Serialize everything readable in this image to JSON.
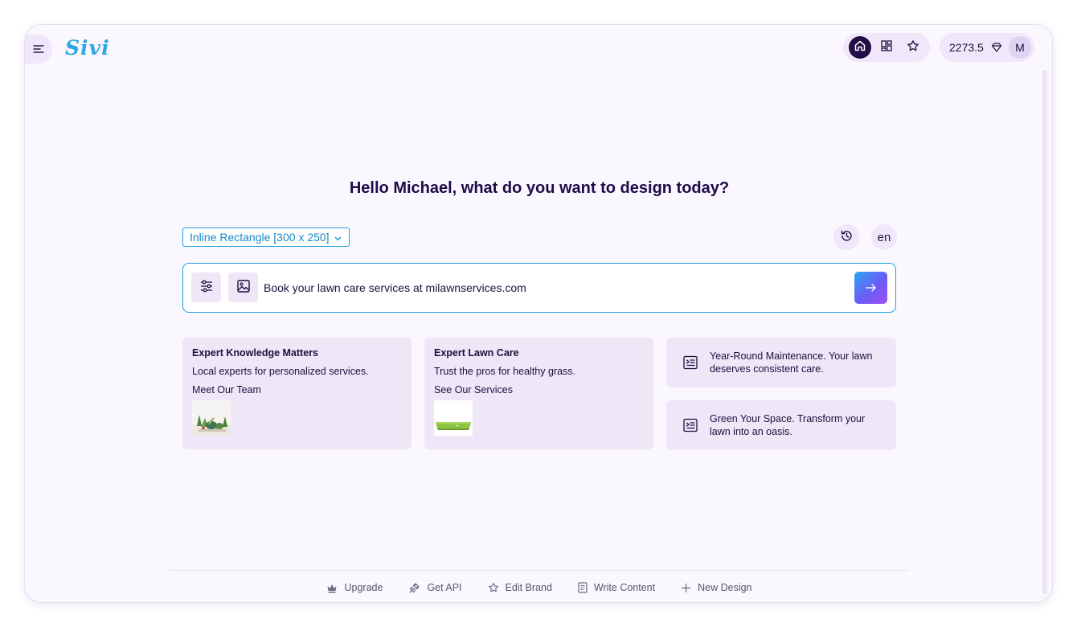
{
  "app": {
    "logo": "Sivi"
  },
  "topbar": {
    "nav": [
      {
        "name": "home",
        "icon": "home-icon",
        "active": true
      },
      {
        "name": "templates",
        "icon": "grid-icon",
        "active": false
      },
      {
        "name": "favorites",
        "icon": "star-icon",
        "active": false
      }
    ],
    "credits": "2273.5",
    "credits_icon": "diamond-icon",
    "avatar_initial": "M"
  },
  "main": {
    "headline": "Hello Michael, what do you want to design today?",
    "size_select": {
      "value": "Inline Rectangle [300 x 250]",
      "icon": "chevron-down-icon"
    },
    "language": "en",
    "prompt": {
      "value": "Book your lawn care services at milawnservices.com",
      "placeholder": ""
    }
  },
  "suggestions": {
    "cards": [
      {
        "title": "Expert Knowledge Matters",
        "description": "Local experts for personalized services.",
        "cta": "Meet Our Team",
        "thumbnail": "succulent-plants-image"
      },
      {
        "title": "Expert Lawn Care",
        "description": "Trust the pros for healthy grass.",
        "cta": "See Our Services",
        "thumbnail": "grass-turf-image"
      }
    ],
    "prompts": [
      {
        "text": "Year-Round Maintenance. Your lawn deserves consistent care.",
        "icon": "document-icon"
      },
      {
        "text": "Green Your Space. Transform your lawn into an oasis.",
        "icon": "document-icon"
      }
    ]
  },
  "footer": {
    "items": [
      {
        "label": "Upgrade",
        "icon": "crown-icon"
      },
      {
        "label": "Get API",
        "icon": "plug-icon"
      },
      {
        "label": "Edit Brand",
        "icon": "star-icon"
      },
      {
        "label": "Write Content",
        "icon": "document-icon"
      },
      {
        "label": "New Design",
        "icon": "plus-icon"
      }
    ]
  },
  "colors": {
    "accent_blue": "#1f9fdc",
    "dark_navy": "#230d47",
    "lavender_bg": "#faf7fe",
    "card_bg": "#efe6f8"
  }
}
